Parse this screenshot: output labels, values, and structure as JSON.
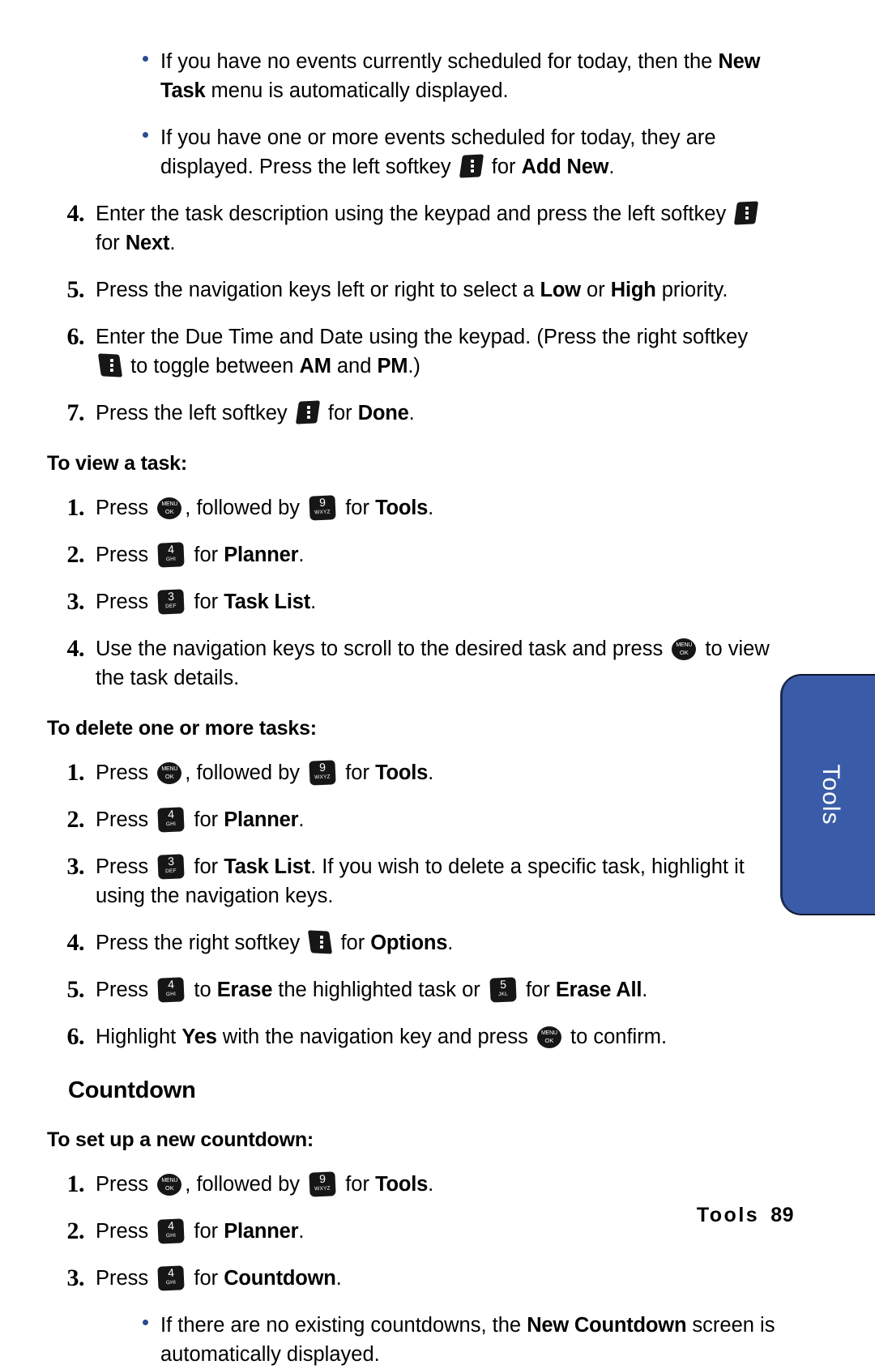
{
  "document": {
    "type": "phone-user-manual-page",
    "page_number": "89",
    "footer_section": "Tools"
  },
  "side_tab": {
    "label": "Tools",
    "color": "#3a5ca8"
  },
  "icons": {
    "left_softkey": "left-softkey-icon",
    "right_softkey": "right-softkey-icon",
    "menu_ok": "menu-ok-key-icon",
    "key_3": "keypad-3-key-icon",
    "key_4": "keypad-4-key-icon",
    "key_5": "keypad-5-key-icon",
    "key_9": "keypad-9-key-icon"
  },
  "keys": {
    "menu": {
      "line1": "MENU",
      "line2": "OK"
    },
    "k3": {
      "digit": "3",
      "letters": "DEF"
    },
    "k4": {
      "digit": "4",
      "letters": "GHI"
    },
    "k5": {
      "digit": "5",
      "letters": "JKL"
    },
    "k9": {
      "digit": "9",
      "letters": "WXYZ"
    }
  },
  "content": {
    "top_bullets": [
      {
        "parts": [
          {
            "t": "If you have no events currently scheduled for today, then the "
          },
          {
            "t": "New Task",
            "b": true
          },
          {
            "t": " menu is automatically displayed."
          }
        ]
      },
      {
        "parts": [
          {
            "t": "If you have one or more events scheduled for today, they are displayed. Press the left softkey "
          },
          {
            "icon": "left_softkey"
          },
          {
            "t": " for "
          },
          {
            "t": "Add New",
            "b": true
          },
          {
            "t": "."
          }
        ]
      }
    ],
    "task_steps": [
      {
        "num": "4.",
        "parts": [
          {
            "t": "Enter the task description using the keypad and press the left softkey "
          },
          {
            "icon": "left_softkey"
          },
          {
            "t": " for "
          },
          {
            "t": "Next",
            "b": true
          },
          {
            "t": "."
          }
        ]
      },
      {
        "num": "5.",
        "parts": [
          {
            "t": "Press the navigation keys left or right to select a "
          },
          {
            "t": "Low",
            "b": true
          },
          {
            "t": " or "
          },
          {
            "t": "High",
            "b": true
          },
          {
            "t": " priority."
          }
        ]
      },
      {
        "num": "6.",
        "parts": [
          {
            "t": "Enter the Due Time and Date using the keypad. (Press the right softkey "
          },
          {
            "icon": "right_softkey"
          },
          {
            "t": " to toggle between "
          },
          {
            "t": "AM",
            "b": true
          },
          {
            "t": " and "
          },
          {
            "t": "PM",
            "b": true
          },
          {
            "t": ".)"
          }
        ]
      },
      {
        "num": "7.",
        "parts": [
          {
            "t": "Press the left softkey "
          },
          {
            "icon": "left_softkey"
          },
          {
            "t": " for "
          },
          {
            "t": "Done",
            "b": true
          },
          {
            "t": "."
          }
        ]
      }
    ],
    "view_task_heading": "To view a task:",
    "view_task_steps": [
      {
        "num": "1.",
        "parts": [
          {
            "t": "Press "
          },
          {
            "icon": "menu_ok"
          },
          {
            "t": ", followed by "
          },
          {
            "icon": "key_9"
          },
          {
            "t": " for "
          },
          {
            "t": "Tools",
            "b": true
          },
          {
            "t": "."
          }
        ]
      },
      {
        "num": "2.",
        "parts": [
          {
            "t": "Press "
          },
          {
            "icon": "key_4"
          },
          {
            "t": " for "
          },
          {
            "t": "Planner",
            "b": true
          },
          {
            "t": "."
          }
        ]
      },
      {
        "num": "3.",
        "parts": [
          {
            "t": "Press "
          },
          {
            "icon": "key_3"
          },
          {
            "t": " for "
          },
          {
            "t": "Task List",
            "b": true
          },
          {
            "t": "."
          }
        ]
      },
      {
        "num": "4.",
        "parts": [
          {
            "t": "Use the navigation keys to scroll to the desired task and press "
          },
          {
            "icon": "menu_ok"
          },
          {
            "t": " to view the task details."
          }
        ]
      }
    ],
    "delete_tasks_heading": "To delete one or more tasks:",
    "delete_tasks_steps": [
      {
        "num": "1.",
        "parts": [
          {
            "t": "Press "
          },
          {
            "icon": "menu_ok"
          },
          {
            "t": ", followed by "
          },
          {
            "icon": "key_9"
          },
          {
            "t": " for "
          },
          {
            "t": "Tools",
            "b": true
          },
          {
            "t": "."
          }
        ]
      },
      {
        "num": "2.",
        "parts": [
          {
            "t": "Press "
          },
          {
            "icon": "key_4"
          },
          {
            "t": " for "
          },
          {
            "t": "Planner",
            "b": true
          },
          {
            "t": "."
          }
        ]
      },
      {
        "num": "3.",
        "parts": [
          {
            "t": "Press "
          },
          {
            "icon": "key_3"
          },
          {
            "t": " for "
          },
          {
            "t": "Task List",
            "b": true
          },
          {
            "t": ". If you wish to delete a specific task, highlight it using the navigation keys."
          }
        ]
      },
      {
        "num": "4.",
        "parts": [
          {
            "t": "Press the right softkey "
          },
          {
            "icon": "right_softkey"
          },
          {
            "t": " for "
          },
          {
            "t": "Options",
            "b": true
          },
          {
            "t": "."
          }
        ]
      },
      {
        "num": "5.",
        "parts": [
          {
            "t": "Press "
          },
          {
            "icon": "key_4"
          },
          {
            "t": " to "
          },
          {
            "t": "Erase",
            "b": true
          },
          {
            "t": " the highlighted task or "
          },
          {
            "icon": "key_5"
          },
          {
            "t": " for "
          },
          {
            "t": "Erase All",
            "b": true
          },
          {
            "t": "."
          }
        ]
      },
      {
        "num": "6.",
        "parts": [
          {
            "t": "Highlight "
          },
          {
            "t": "Yes",
            "b": true
          },
          {
            "t": " with the navigation key and press "
          },
          {
            "icon": "menu_ok"
          },
          {
            "t": " to confirm."
          }
        ]
      }
    ],
    "countdown_heading": "Countdown",
    "countdown_sub_heading": "To set up a new countdown:",
    "countdown_steps": [
      {
        "num": "1.",
        "parts": [
          {
            "t": "Press "
          },
          {
            "icon": "menu_ok"
          },
          {
            "t": ", followed by "
          },
          {
            "icon": "key_9"
          },
          {
            "t": " for "
          },
          {
            "t": "Tools",
            "b": true
          },
          {
            "t": "."
          }
        ]
      },
      {
        "num": "2.",
        "parts": [
          {
            "t": "Press "
          },
          {
            "icon": "key_4"
          },
          {
            "t": " for "
          },
          {
            "t": "Planner",
            "b": true
          },
          {
            "t": "."
          }
        ]
      },
      {
        "num": "3.",
        "parts": [
          {
            "t": "Press "
          },
          {
            "icon": "key_4"
          },
          {
            "t": " for "
          },
          {
            "t": "Countdown",
            "b": true
          },
          {
            "t": "."
          }
        ]
      }
    ],
    "countdown_bullets": [
      {
        "parts": [
          {
            "t": "If there are no existing countdowns, the "
          },
          {
            "t": "New Countdown",
            "b": true
          },
          {
            "t": " screen is automatically displayed."
          }
        ]
      }
    ]
  }
}
